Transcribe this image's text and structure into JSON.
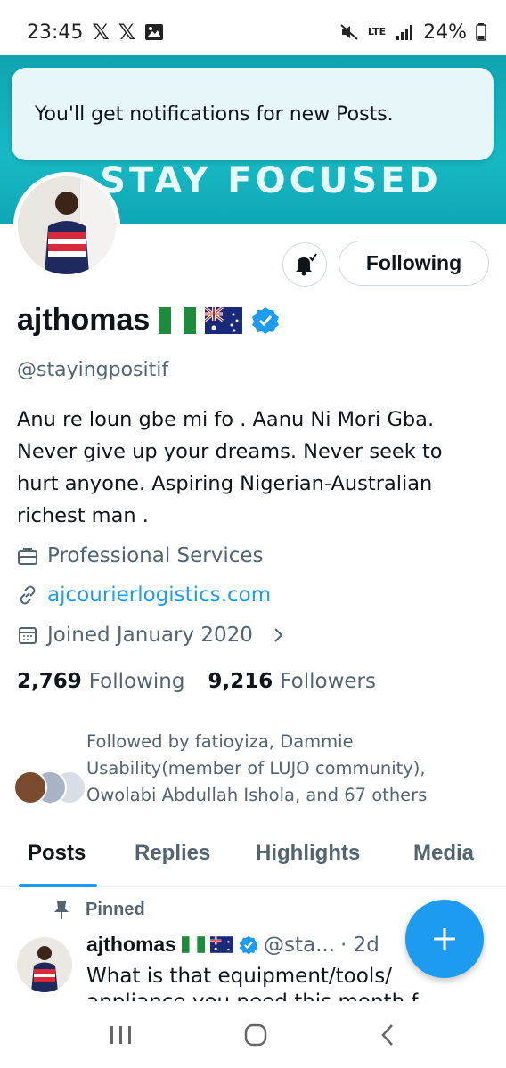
{
  "status_bar": {
    "time": "23:45",
    "battery": "24%",
    "network": "LTE"
  },
  "toast": {
    "message": "You'll get notifications for new Posts."
  },
  "banner": {
    "text": "STAY FOCUSED"
  },
  "profile": {
    "following_button": "Following",
    "display_name": "ajthomas",
    "handle": "@stayingpositif",
    "bio": "Anu re loun gbe mi fo . Aanu Ni Mori Gba. Never give up your dreams. Never seek to hurt anyone. Aspiring Nigerian-Australian richest man .",
    "category": "Professional Services",
    "website": "ajcourierlogistics.com",
    "joined": "Joined January 2020",
    "following_count": "2,769",
    "following_label": "Following",
    "followers_count": "9,216",
    "followers_label": "Followers",
    "followed_by": "Followed by fatioyiza, Dammie Usability(member of LUJO community), Owolabi Abdullah Ishola, and 67 others"
  },
  "tabs": [
    {
      "label": "Posts"
    },
    {
      "label": "Replies"
    },
    {
      "label": "Highlights"
    },
    {
      "label": "Media"
    }
  ],
  "post": {
    "pinned_label": "Pinned",
    "name": "ajthomas",
    "handle": "@sta...",
    "time": "· 2d",
    "text": "What is that equipment/tools/",
    "text_cont": "appliance you need this month f"
  },
  "colors": {
    "accent": "#1d9bf0",
    "banner": "#17b9c4",
    "secondary_text": "#536471"
  }
}
